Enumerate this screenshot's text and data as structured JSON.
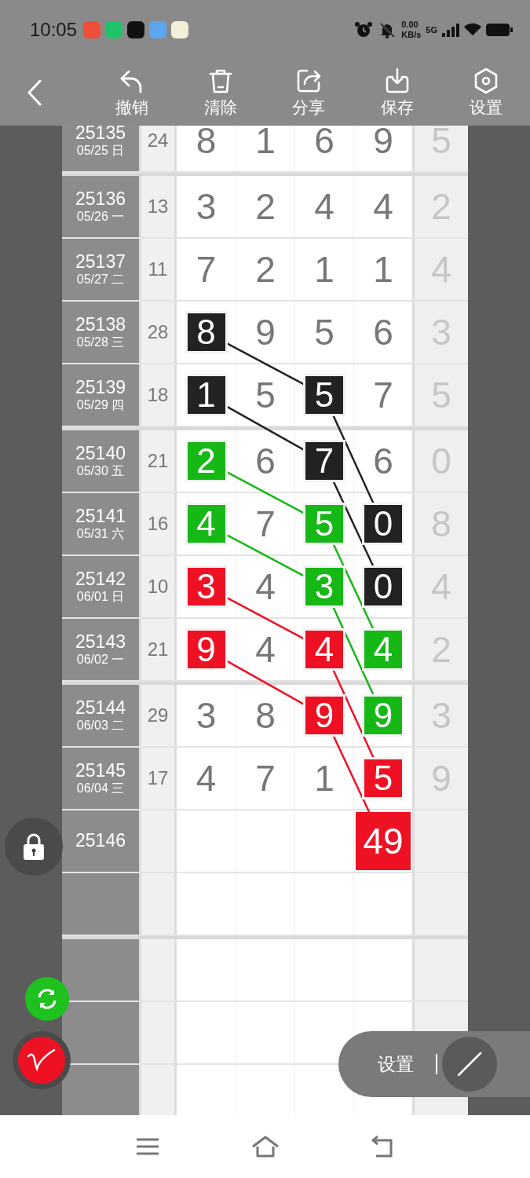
{
  "status_bar": {
    "time": "10:05",
    "network_speed": "0.00",
    "speed_unit": "KB/s",
    "network": "5G"
  },
  "toolbar": {
    "actions": [
      {
        "label": "撤销",
        "kind": "undo"
      },
      {
        "label": "清除",
        "kind": "clear"
      },
      {
        "label": "分享",
        "kind": "share"
      },
      {
        "label": "保存",
        "kind": "save"
      },
      {
        "label": "设置",
        "kind": "settings"
      }
    ]
  },
  "rows": [
    {
      "issue": "25135",
      "date": "05/25 日",
      "sum": "24",
      "digits": [
        {
          "value": "8"
        },
        {
          "value": "1"
        },
        {
          "value": "6"
        },
        {
          "value": "9"
        }
      ],
      "tail": "5"
    },
    {
      "issue": "25136",
      "date": "05/26 一",
      "sum": "13",
      "digits": [
        {
          "value": "3"
        },
        {
          "value": "2"
        },
        {
          "value": "4"
        },
        {
          "value": "4"
        }
      ],
      "tail": "2"
    },
    {
      "issue": "25137",
      "date": "05/27 二",
      "sum": "11",
      "digits": [
        {
          "value": "7"
        },
        {
          "value": "2"
        },
        {
          "value": "1"
        },
        {
          "value": "1"
        }
      ],
      "tail": "4"
    },
    {
      "issue": "25138",
      "date": "05/28 三",
      "sum": "28",
      "digits": [
        {
          "value": "8",
          "color": "#222222"
        },
        {
          "value": "9"
        },
        {
          "value": "5"
        },
        {
          "value": "6"
        }
      ],
      "tail": "3"
    },
    {
      "issue": "25139",
      "date": "05/29 四",
      "sum": "18",
      "digits": [
        {
          "value": "1",
          "color": "#222222"
        },
        {
          "value": "5"
        },
        {
          "value": "5",
          "color": "#222222"
        },
        {
          "value": "7"
        }
      ],
      "tail": "5"
    },
    {
      "issue": "25140",
      "date": "05/30 五",
      "sum": "21",
      "digits": [
        {
          "value": "2",
          "color": "#16b816"
        },
        {
          "value": "6"
        },
        {
          "value": "7",
          "color": "#222222"
        },
        {
          "value": "6"
        }
      ],
      "tail": "0"
    },
    {
      "issue": "25141",
      "date": "05/31 六",
      "sum": "16",
      "digits": [
        {
          "value": "4",
          "color": "#16b816"
        },
        {
          "value": "7"
        },
        {
          "value": "5",
          "color": "#16b816"
        },
        {
          "value": "0",
          "color": "#222222"
        }
      ],
      "tail": "8"
    },
    {
      "issue": "25142",
      "date": "06/01 日",
      "sum": "10",
      "digits": [
        {
          "value": "3",
          "color": "#ee1124"
        },
        {
          "value": "4"
        },
        {
          "value": "3",
          "color": "#16b816"
        },
        {
          "value": "0",
          "color": "#222222"
        }
      ],
      "tail": "4"
    },
    {
      "issue": "25143",
      "date": "06/02 一",
      "sum": "21",
      "digits": [
        {
          "value": "9",
          "color": "#ee1124"
        },
        {
          "value": "4"
        },
        {
          "value": "4",
          "color": "#ee1124"
        },
        {
          "value": "4",
          "color": "#16b816"
        }
      ],
      "tail": "2"
    },
    {
      "issue": "25144",
      "date": "06/03 二",
      "sum": "29",
      "digits": [
        {
          "value": "3"
        },
        {
          "value": "8"
        },
        {
          "value": "9",
          "color": "#ee1124"
        },
        {
          "value": "9",
          "color": "#16b816"
        }
      ],
      "tail": "3"
    },
    {
      "issue": "25145",
      "date": "06/04 三",
      "sum": "17",
      "digits": [
        {
          "value": "4"
        },
        {
          "value": "7"
        },
        {
          "value": "1"
        },
        {
          "value": "5",
          "color": "#ee1124"
        }
      ],
      "tail": "9"
    },
    {
      "issue": "25146",
      "digits": [
        {
          "kind": "blank"
        },
        {
          "kind": "blank"
        },
        {
          "kind": "blank"
        },
        {
          "kind": "number",
          "value": "49",
          "color": "#ee1124"
        }
      ]
    }
  ],
  "floating_menu": {
    "label": "设置"
  }
}
